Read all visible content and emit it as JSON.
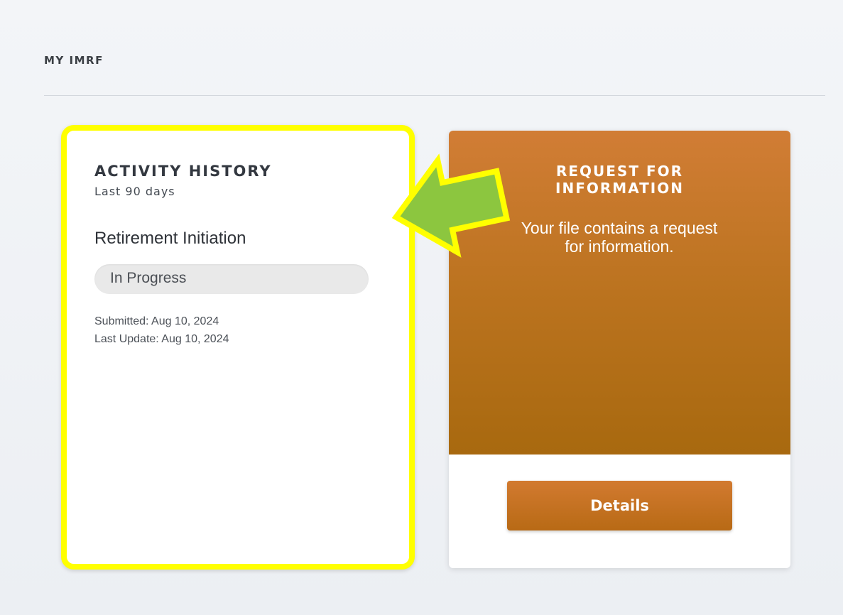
{
  "section": {
    "title": "MY IMRF"
  },
  "activity": {
    "heading": "ACTIVITY HISTORY",
    "subheading": "Last 90 days",
    "item_name": "Retirement Initiation",
    "status": "In Progress",
    "submitted": "Submitted: Aug 10, 2024",
    "last_update": "Last Update: Aug 10, 2024"
  },
  "request": {
    "heading_line1": "REQUEST FOR",
    "heading_line2": "INFORMATION",
    "message_line1": "Your file contains a request",
    "message_line2": "for information.",
    "button_label": "Details"
  },
  "colors": {
    "highlight_border": "#ffff00",
    "arrow_fill": "#8cc63f",
    "request_accent": "#c0741f"
  }
}
